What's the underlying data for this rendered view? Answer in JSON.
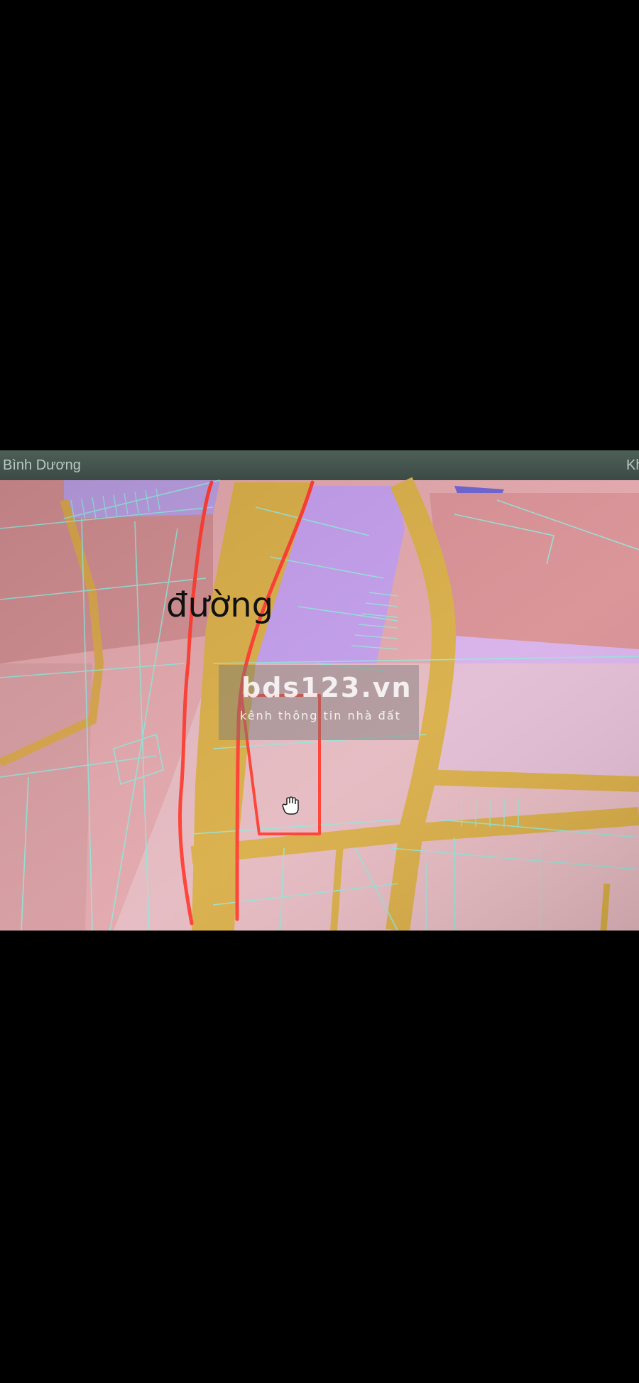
{
  "window": {
    "title_left": "Bình Dương",
    "title_right": "Kh"
  },
  "map": {
    "annotation_label": "đường",
    "cursor_icon": "hand-cursor-icon",
    "colors": {
      "residential": "#e4a5aa",
      "industrial": "#c89ce6",
      "road": "#d9b64a",
      "parcel_line": "#8fe8da",
      "annotation": "#ff3b30"
    }
  },
  "watermark": {
    "brand": "bds123.vn",
    "tagline": "kênh thông tin nhà đất"
  }
}
